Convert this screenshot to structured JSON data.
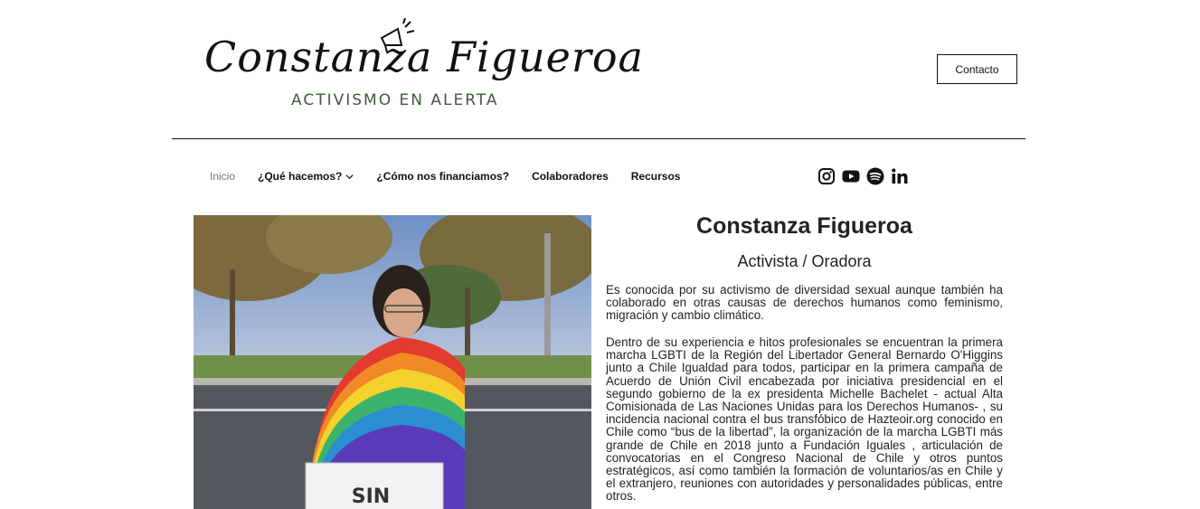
{
  "header": {
    "logo_title": "Constanza Figueroa",
    "logo_subtitle": "ACTIVISMO EN ALERTA",
    "contact_label": "Contacto"
  },
  "nav": {
    "items": [
      {
        "label": "Inicio",
        "active": true
      },
      {
        "label": "¿Qué hacemos?",
        "dropdown": true
      },
      {
        "label": "¿Cómo nos financiamos?"
      },
      {
        "label": "Colaboradores"
      },
      {
        "label": "Recursos"
      }
    ],
    "social": [
      "instagram-icon",
      "youtube-icon",
      "spotify-icon",
      "linkedin-icon"
    ]
  },
  "main": {
    "photo_sign_text": "SIN",
    "name": "Constanza Figueroa",
    "role": "Activista / Oradora",
    "paragraph1": "Es conocida por su activismo de diversidad sexual aunque también ha colaborado en otras causas de derechos humanos como feminismo, migración y cambio climático.",
    "paragraph2": "Dentro de su experiencia e hitos profesionales se encuentran la primera marcha LGBTI de la Región del Libertador General Bernardo O'Higgins junto a Chile Igualdad para todos, participar en la primera campaña de Acuerdo de Unión Civil encabezada por iniciativa presidencial en el segundo gobierno de la ex presidenta Michelle Bachelet - actual Alta Comisionada de Las Naciones Unidas para los Derechos Humanos- , su incidencia nacional contra el bus transfóbico de Hazteoir.org conocido en Chile como “bus de la libertad”, la organización de la marcha LGBTI más grande de Chile en 2018 junto a Fundación Iguales , articulación de convocatorias en el Congreso Nacional de Chile y otros puntos estratégicos, así como también la formación de voluntarios/as en Chile y el extranjero, reuniones con autoridades y personalidades públicas, entre otros."
  },
  "colors": {
    "logo_subtitle": "#3f5a3a",
    "text": "#222222",
    "nav_active": "#777777"
  }
}
